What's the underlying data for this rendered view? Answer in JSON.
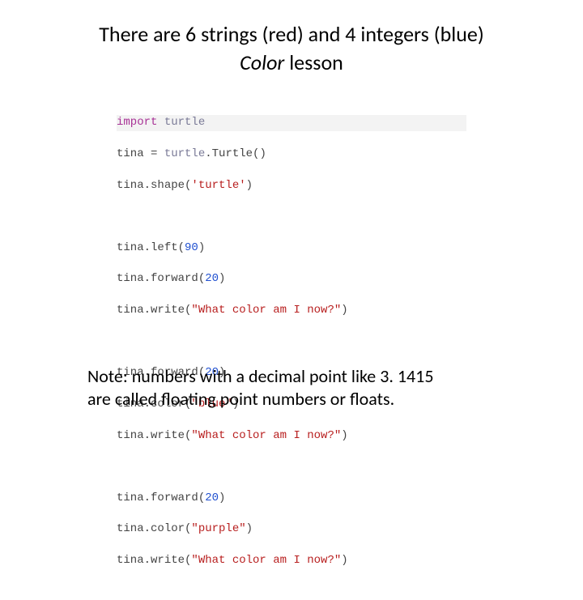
{
  "title": {
    "line1": "There are 6 strings (red) and 4 integers (blue)",
    "line2_italic": "Color",
    "line2_rest": " lesson"
  },
  "code": {
    "l1_kw": "import",
    "l1_mod": " turtle",
    "l2a": "tina ",
    "l2b": "=",
    "l2c": " turtle",
    "l2d": ".Turtle()",
    "l3a": "tina",
    "l3b": ".shape(",
    "l3s": "'turtle'",
    "l3c": ")",
    "l4a": "tina",
    "l4b": ".left(",
    "l4n": "90",
    "l4c": ")",
    "l5a": "tina",
    "l5b": ".forward(",
    "l5n": "20",
    "l5c": ")",
    "l6a": "tina",
    "l6b": ".write(",
    "l6s": "\"What color am I now?\"",
    "l6c": ")",
    "l7a": "tina",
    "l7b": ".forward(",
    "l7n": "20",
    "l7c": ")",
    "l8a": "tina",
    "l8b": ".color(",
    "l8s": "\"blue\"",
    "l8c": ")",
    "l9a": "tina",
    "l9b": ".write(",
    "l9s": "\"What color am I now?\"",
    "l9c": ")",
    "l10a": "tina",
    "l10b": ".forward(",
    "l10n": "20",
    "l10c": ")",
    "l11a": "tina",
    "l11b": ".color(",
    "l11s": "\"purple\"",
    "l11c": ")",
    "l12a": "tina",
    "l12b": ".write(",
    "l12s": "\"What color am I now?\"",
    "l12c": ")"
  },
  "note": {
    "line1": "Note: numbers with a decimal point like 3. 1415",
    "line2": "are called floating point numbers or floats."
  }
}
